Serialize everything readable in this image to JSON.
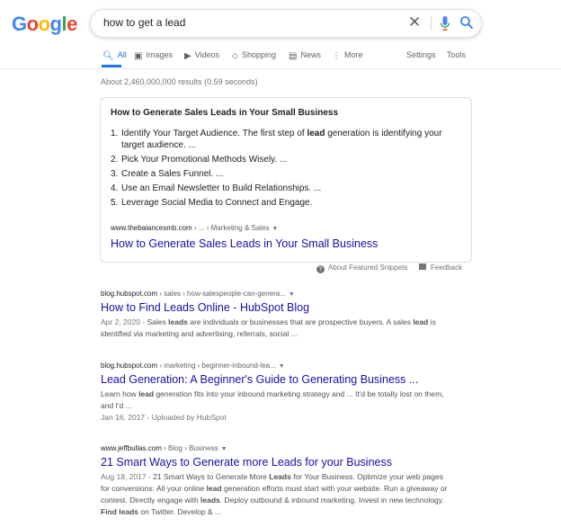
{
  "logo": {
    "text": "Google",
    "letters": [
      "G",
      "o",
      "o",
      "g",
      "l",
      "e"
    ],
    "colors": [
      "#4285f4",
      "#ea4335",
      "#fbbc05",
      "#4285f4",
      "#34a853",
      "#ea4335"
    ]
  },
  "search": {
    "query": "how to get a lead"
  },
  "icons": {
    "clear": "close-icon",
    "mic": "mic-icon",
    "search": "search-icon"
  },
  "tabs": [
    {
      "label": "All",
      "icon": "search-icon"
    },
    {
      "label": "Images",
      "icon": "image-icon"
    },
    {
      "label": "Videos",
      "icon": "video-icon"
    },
    {
      "label": "Shopping",
      "icon": "tag-icon"
    },
    {
      "label": "News",
      "icon": "news-icon"
    },
    {
      "label": "More",
      "icon": "more-icon"
    },
    {
      "label": "Settings"
    },
    {
      "label": "Tools"
    }
  ],
  "stats": "About 2,460,000,000 results (0.59 seconds)",
  "featured": {
    "heading": "How to Generate Sales Leads in Your Small Business",
    "items": [
      {
        "num": "1.",
        "pre": "Identify Your Target Audience. The first step of ",
        "bold": "lead",
        "post": " generation is identifying your target audience. ..."
      },
      {
        "num": "2.",
        "pre": "Pick Your Promotional Methods Wisely. ..."
      },
      {
        "num": "3.",
        "pre": "Create a Sales Funnel. ..."
      },
      {
        "num": "4.",
        "pre": "Use an Email Newsletter to Build Relationships. ..."
      },
      {
        "num": "5.",
        "pre": "Leverage Social Media to Connect and Engage."
      }
    ],
    "cite_domain": "www.thebalancesmb.com",
    "cite_path": " › ... › Marketing & Sales",
    "link": "How to Generate Sales Leads in Your Small Business"
  },
  "about_snippets": "About Featured Snippets",
  "feedback": "Feedback",
  "results": [
    {
      "domain": "blog.hubspot.com",
      "path": " › sales › how-salespeople-can-genera...",
      "title": "How to Find Leads Online - HubSpot Blog",
      "date": "Apr 2, 2020 - ",
      "snippet_parts": [
        "Sales ",
        "leads",
        " are individuals or businesses that are prospective buyers. A sales ",
        "lead",
        " is identified via marketing and advertising, referrals, social ..."
      ]
    },
    {
      "domain": "blog.hubspot.com",
      "path": " › marketing › beginner-inbound-lea...",
      "title": "Lead Generation: A Beginner's Guide to Generating Business ...",
      "snippet_parts": [
        "Learn how ",
        "lead",
        " generation fits into your inbound marketing strategy and ... It'd be totally lost on them, and I'd ..."
      ],
      "extra": "Jan 16, 2017 - Uploaded by HubSpot"
    },
    {
      "domain": "www.jeffbullas.com",
      "path": " › Blog › Business",
      "title": "21 Smart Ways to Generate more Leads for your Business",
      "date": "Aug 18, 2017 - ",
      "snippet_parts": [
        "21 Smart Ways to Generate More ",
        "Leads",
        " for Your Business. Optimize your web pages for conversions: All your online ",
        "lead",
        " generation efforts must start with your website. Run a giveaway or contest. Directly engage with ",
        "leads",
        ". Deploy outbound & inbound marketing. Invest in new technology. ",
        "Find leads",
        " on Twitter. Develop & ..."
      ]
    }
  ]
}
